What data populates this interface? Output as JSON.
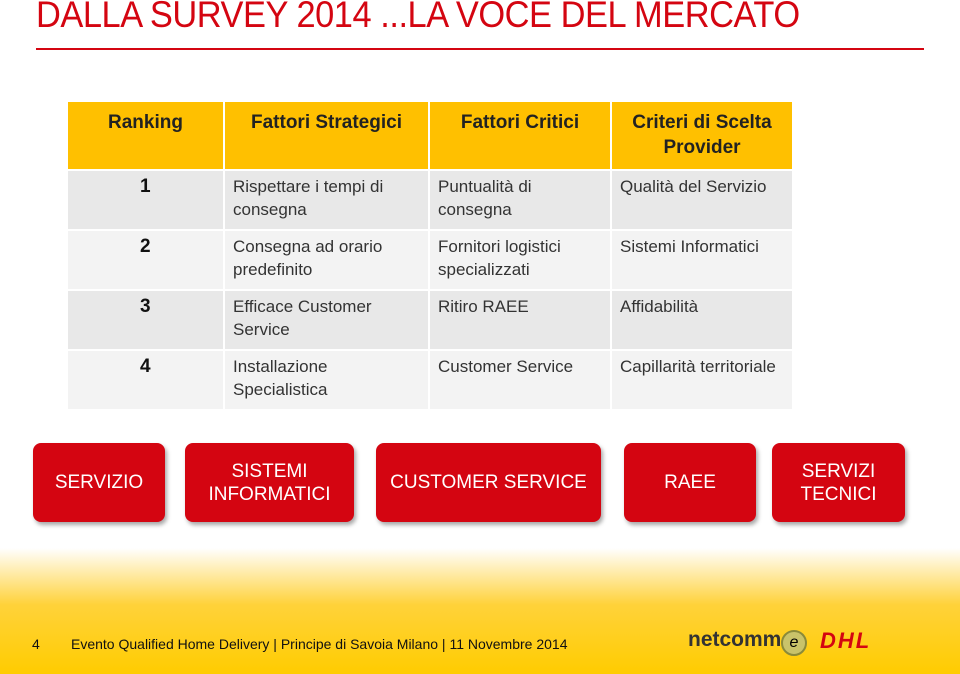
{
  "title": "DALLA SURVEY 2014 ...LA VOCE DEL MERCATO",
  "table": {
    "headers": [
      "Ranking",
      "Fattori Strategici",
      "Fattori Critici",
      "Criteri di Scelta Provider"
    ],
    "rows": [
      [
        "1",
        "Rispettare i tempi di consegna",
        "Puntualità di consegna",
        "Qualità del Servizio"
      ],
      [
        "2",
        "Consegna ad orario predefinito",
        "Fornitori logistici specializzati",
        "Sistemi Informatici"
      ],
      [
        "3",
        "Efficace Customer Service",
        "Ritiro RAEE",
        "Affidabilità"
      ],
      [
        "4",
        "Installazione Specialistica",
        "Customer Service",
        "Capillarità territoriale"
      ]
    ]
  },
  "buttons": [
    "SERVIZIO",
    "SISTEMI INFORMATICI",
    "CUSTOMER SERVICE",
    "RAEE",
    "SERVIZI TECNICI"
  ],
  "footer": {
    "page": "4",
    "text": "Evento Qualified Home Delivery | Principe di Savoia Milano | 11 Novembre 2014",
    "logo1": "netcomm",
    "logo2": "DHL"
  },
  "colors": {
    "accent": "#d40511",
    "header": "#ffc000"
  }
}
